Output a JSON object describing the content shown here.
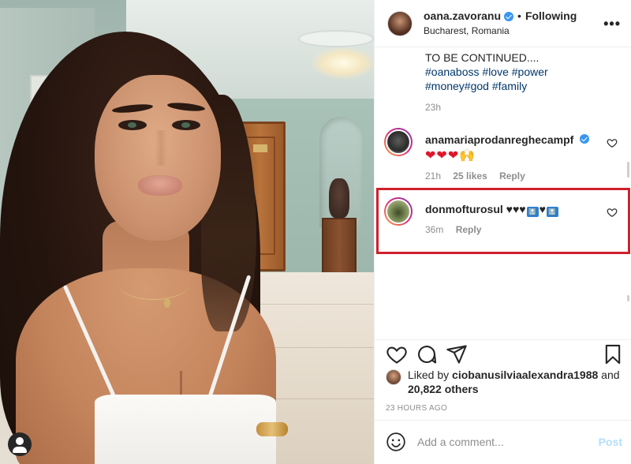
{
  "header": {
    "username": "oana.zavoranu",
    "separator": "•",
    "follow_status": "Following",
    "location": "Bucharest, Romania",
    "more_label": "•••"
  },
  "caption": {
    "line1": "TO BE CONTINUED....",
    "hashtags_line1": [
      "#oanaboss",
      "#love",
      "#power"
    ],
    "hashtags_line2": [
      "#money#god",
      "#family"
    ],
    "time": "23h"
  },
  "comments": [
    {
      "username": "anamariaprodanreghecampf",
      "verified": true,
      "text": "❤❤❤🙌",
      "time": "21h",
      "likes": "25 likes",
      "reply": "Reply"
    },
    {
      "username": "donmofturosul",
      "verified": false,
      "text": "♥♥♥",
      "emoji_badges": [
        "🔝",
        "🔝"
      ],
      "between_heart": "♥",
      "time": "36m",
      "reply": "Reply"
    }
  ],
  "likes": {
    "prefix": "Liked by ",
    "user": "ciobanusilviaalexandra1988",
    "conj": " and",
    "count": "20,822 others"
  },
  "post_time": "23 HOURS AGO",
  "add_comment": {
    "placeholder": "Add a comment...",
    "post_label": "Post"
  },
  "colors": {
    "verified": "#3897f0",
    "highlight": "#d0202d",
    "hashtag": "#00376b",
    "post_button": "#b2dffc"
  }
}
